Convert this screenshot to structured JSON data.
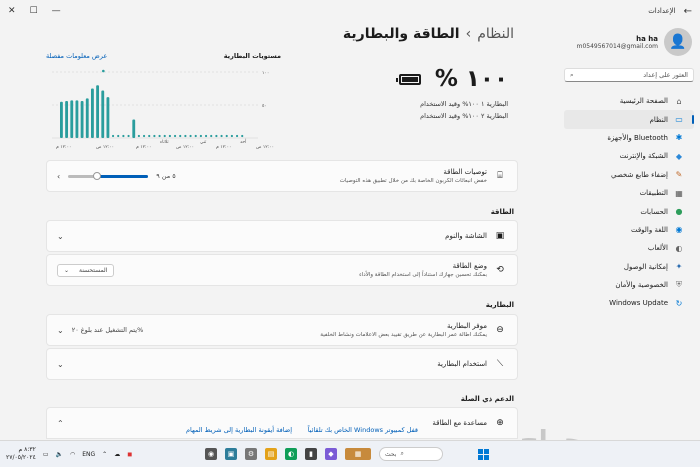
{
  "window": {
    "title": "الإعدادات",
    "back": "←",
    "minimize": "—",
    "maximize": "☐",
    "close": "✕"
  },
  "profile": {
    "name": "ha ha",
    "email": "m0549567014@gmail.com"
  },
  "search": {
    "placeholder": "العثور على إعداد"
  },
  "nav": [
    {
      "label": "الصفحة الرئيسية",
      "icon": "home-icon",
      "glyph": "⌂",
      "color": "#555555"
    },
    {
      "label": "النظام",
      "icon": "system-icon",
      "glyph": "▭",
      "color": "#0078d4"
    },
    {
      "label": "Bluetooth والأجهزة",
      "icon": "bluetooth-icon",
      "glyph": "✱",
      "color": "#0078d4"
    },
    {
      "label": "الشبكة والإنترنت",
      "icon": "network-icon",
      "glyph": "◆",
      "color": "#2b88d8"
    },
    {
      "label": "إضفاء طابع شخصي",
      "icon": "personalization-icon",
      "glyph": "✎",
      "color": "#c06a2b"
    },
    {
      "label": "التطبيقات",
      "icon": "apps-icon",
      "glyph": "▦",
      "color": "#555555"
    },
    {
      "label": "الحسابات",
      "icon": "accounts-icon",
      "glyph": "●",
      "color": "#2d9d5b"
    },
    {
      "label": "اللغة والوقت",
      "icon": "language-icon",
      "glyph": "◉",
      "color": "#0078d4"
    },
    {
      "label": "الألعاب",
      "icon": "gaming-icon",
      "glyph": "◐",
      "color": "#666666"
    },
    {
      "label": "إمكانية الوصول",
      "icon": "accessibility-icon",
      "glyph": "✦",
      "color": "#2b6cb0"
    },
    {
      "label": "الخصوصية والأمان",
      "icon": "privacy-icon",
      "glyph": "⛨",
      "color": "#777777"
    },
    {
      "label": "Windows Update",
      "icon": "update-icon",
      "glyph": "↻",
      "color": "#0078d4"
    }
  ],
  "breadcrumb": {
    "parent": "النظام",
    "separator": "›",
    "current": "الطاقة والبطارية"
  },
  "battery": {
    "percent": "١٠٠ %",
    "est1": "البطارية ١ ١٠٠% وقيد الاستخدام",
    "est2": "البطارية ٢ ١٠٠% وقيد الاستخدام"
  },
  "chart": {
    "title": "مستويات البطارية",
    "link": "عرض معلومات مفصلة",
    "yticks": [
      "١٠٠",
      "٥٠"
    ],
    "xticks": [
      "١٢:٠٠ م",
      "١٢:٠٠ ص",
      "١٢:٠٠ م",
      "١٢:٠٠ ص",
      "١٢:٠٠ م",
      "١٢:٠٠ ص"
    ],
    "days": [
      "ثلاثاء",
      "ثني",
      "أحد"
    ]
  },
  "chart_data": {
    "type": "bar",
    "title": "مستويات البطارية",
    "ylim": [
      0,
      100
    ],
    "values": [
      55,
      56,
      57,
      57,
      56,
      60,
      75,
      80,
      72,
      62,
      0,
      0,
      0,
      0,
      28,
      0,
      0,
      0,
      0,
      0,
      0,
      0,
      0,
      0,
      0,
      0,
      0,
      0,
      0,
      0,
      0,
      0,
      0,
      0,
      0,
      0
    ],
    "dots": [
      3,
      3,
      3,
      3,
      3,
      3,
      3,
      3,
      3,
      3,
      3,
      3,
      3,
      3,
      3,
      3,
      3,
      3,
      3,
      3,
      3,
      3,
      3,
      3,
      3,
      3,
      3
    ],
    "color": "#2a9d9d",
    "grid": true
  },
  "recommend": {
    "title": "توصيات الطاقة",
    "sub": "خفض انبعاثات الكربون الخاصة بك من خلال تطبيق هذه التوصيات",
    "count": "٥ من ٩"
  },
  "sections": {
    "power": "الطاقة",
    "battery": "البطارية",
    "support": "الدعم ذي الصلة"
  },
  "screen_sleep": {
    "title": "الشاشة والنوم"
  },
  "power_mode": {
    "title": "وضع الطاقة",
    "sub": "بمكنك تحسين جهازك استناداً إلى استخدام الطاقة والأداء",
    "value": "المستحسنة"
  },
  "saver": {
    "title": "موفر البطارية",
    "sub": "يمكنك اطالة عمر البطارية عن طريق تقييد بعض الاعلامات ونشاط الخلفية",
    "status": "يتم التشغيل عند بلوغ ٢٠%"
  },
  "usage": {
    "title": "استخدام البطارية"
  },
  "help": {
    "title": "مساعدة مع الطاقة"
  },
  "links": {
    "a": "قفل كمبيوتر Windows الخاص بك تلقائياً",
    "b": "إضافة أيقونة البطارية إلى شريط المهام"
  },
  "taskbar": {
    "search": "بحث",
    "lang": "ENG",
    "time": "٨:٣٢ م",
    "date": "٢٧/٠٥/٢٠٢٤",
    "watermark": "حراج"
  }
}
